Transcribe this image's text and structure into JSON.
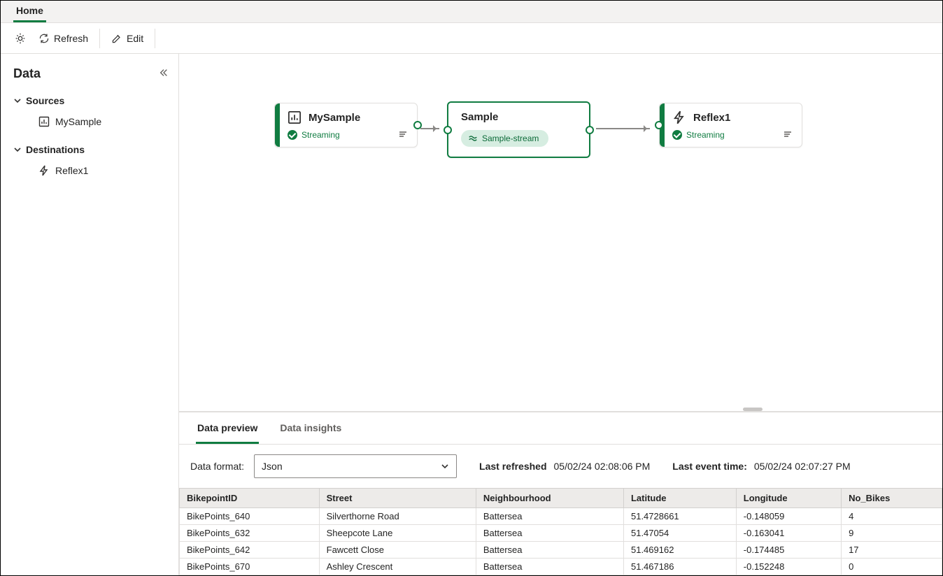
{
  "tabs": {
    "home": "Home"
  },
  "toolbar": {
    "refresh": "Refresh",
    "edit": "Edit"
  },
  "sidebar": {
    "title": "Data",
    "groups": [
      {
        "label": "Sources",
        "items": [
          {
            "label": "MySample"
          }
        ]
      },
      {
        "label": "Destinations",
        "items": [
          {
            "label": "Reflex1"
          }
        ]
      }
    ]
  },
  "nodes": {
    "source": {
      "title": "MySample",
      "status": "Streaming"
    },
    "center": {
      "title": "Sample",
      "chip": "Sample-stream"
    },
    "dest": {
      "title": "Reflex1",
      "status": "Streaming"
    }
  },
  "bottom": {
    "tabs": {
      "preview": "Data preview",
      "insights": "Data insights"
    },
    "format_label": "Data format:",
    "format_value": "Json",
    "last_refreshed_label": "Last refreshed",
    "last_refreshed_value": "05/02/24 02:08:06 PM",
    "last_event_label": "Last event time:",
    "last_event_value": "05/02/24 02:07:27 PM"
  },
  "table": {
    "columns": [
      "BikepointID",
      "Street",
      "Neighbourhood",
      "Latitude",
      "Longitude",
      "No_Bikes"
    ],
    "rows": [
      [
        "BikePoints_640",
        "Silverthorne Road",
        "Battersea",
        "51.4728661",
        "-0.148059",
        "4"
      ],
      [
        "BikePoints_632",
        "Sheepcote Lane",
        "Battersea",
        "51.47054",
        "-0.163041",
        "9"
      ],
      [
        "BikePoints_642",
        "Fawcett Close",
        "Battersea",
        "51.469162",
        "-0.174485",
        "17"
      ],
      [
        "BikePoints_670",
        "Ashley Crescent",
        "Battersea",
        "51.467186",
        "-0.152248",
        "0"
      ]
    ]
  }
}
